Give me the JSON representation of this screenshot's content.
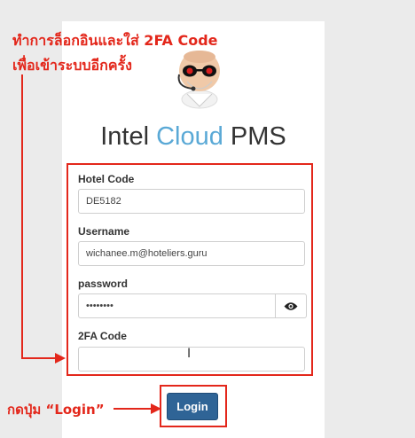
{
  "annotation_top": {
    "line1": "ทำการล็อกอินและใส่ 2FA Code",
    "line2": "เพื่อเข้าระบบอีกครั้ง"
  },
  "annotation_bottom": "กดปุ่ม “Login”",
  "brand": {
    "part1": "Intel ",
    "part2": "Cloud",
    "part3": " PMS"
  },
  "form": {
    "hotel_code_label": "Hotel Code",
    "hotel_code_value": "DE5182",
    "username_label": "Username",
    "username_value": "wichanee.m@hoteliers.guru",
    "password_label": "password",
    "password_value": "••••••••",
    "twofa_label": "2FA Code",
    "twofa_value": ""
  },
  "login_label": "Login",
  "colors": {
    "annotation": "#e3271b",
    "button": "#2f6496",
    "brand_accent": "#5aa9d6"
  },
  "icons": {
    "password_toggle": "eye-icon",
    "text_cursor": "ibeam-cursor-icon",
    "mascot": "mascot-logo"
  }
}
